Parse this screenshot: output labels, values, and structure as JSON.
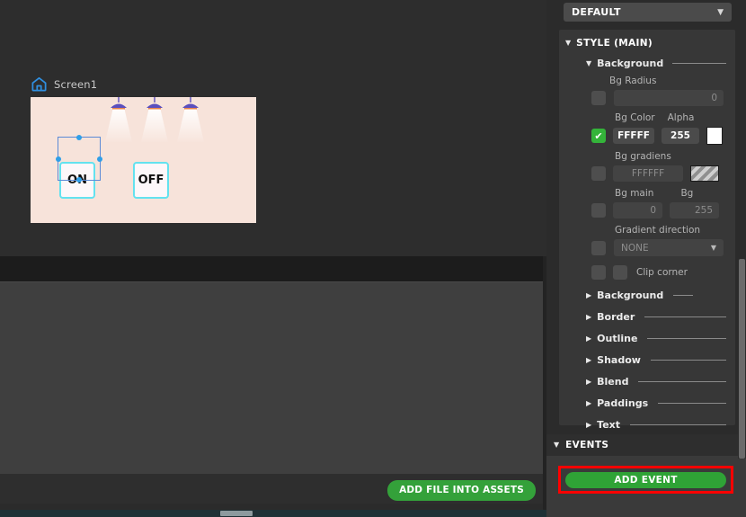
{
  "canvas": {
    "screen_label": "Screen1",
    "home_icon": "home-icon",
    "device": {
      "bg_color": "#f7e3da",
      "lamp_count": 3,
      "buttons": [
        {
          "label": "ON",
          "selected": true
        },
        {
          "label": "OFF",
          "selected": false
        }
      ]
    },
    "assets": {
      "add_file_label": "ADD FILE INTO ASSETS"
    }
  },
  "inspector": {
    "preset_dropdown": {
      "value": "DEFAULT",
      "caret": "chevron-down-icon"
    },
    "style_section": {
      "title": "STYLE (MAIN)",
      "expanded": true,
      "background": {
        "title": "Background",
        "expanded": true,
        "bg_radius": {
          "label": "Bg Radius",
          "value": "0",
          "enabled": false
        },
        "bg_color": {
          "label": "Bg Color",
          "alpha_label": "Alpha",
          "value": "FFFFF",
          "alpha": "255",
          "enabled": true,
          "swatch": "#FFFFFF"
        },
        "bg_gradients": {
          "label": "Bg gradiens",
          "value": "FFFFFF",
          "enabled": false,
          "swatch": "gradient-stripes"
        },
        "bg_main": {
          "label": "Bg main",
          "second_label": "Bg",
          "value": "0",
          "second_value": "255",
          "enabled": false
        },
        "gradient_direction": {
          "label": "Gradient direction",
          "value": "NONE",
          "enabled": false
        },
        "clip_corner": {
          "label": "Clip corner",
          "enabled": false
        }
      },
      "collapsed_sections": [
        {
          "label": "Background",
          "short_rule": true
        },
        {
          "label": "Border",
          "short_rule": false
        },
        {
          "label": "Outline",
          "short_rule": false
        },
        {
          "label": "Shadow",
          "short_rule": false
        },
        {
          "label": "Blend",
          "short_rule": false
        },
        {
          "label": "Paddings",
          "short_rule": false
        },
        {
          "label": "Text",
          "short_rule": false
        }
      ]
    },
    "events_section": {
      "title": "EVENTS",
      "expanded": true,
      "add_event_label": "ADD EVENT",
      "highlight_color": "#ff0000",
      "button_color": "#2fa336"
    }
  },
  "icons": {
    "caret_down": "▼",
    "caret_right": "▶",
    "check": "✔"
  }
}
